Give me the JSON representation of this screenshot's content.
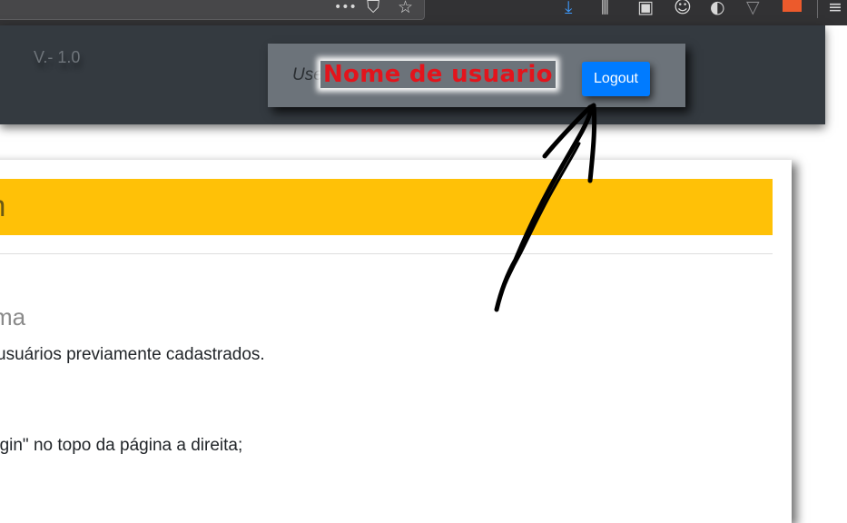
{
  "browser": {
    "toolbar_icons": [
      {
        "name": "more-dots-icon",
        "glyph": "•••"
      },
      {
        "name": "pocket-icon",
        "glyph": "⛉"
      },
      {
        "name": "bookmark-star-icon",
        "glyph": "☆"
      },
      {
        "name": "download-icon",
        "glyph": "⤓"
      },
      {
        "name": "library-icon",
        "glyph": "⫼"
      },
      {
        "name": "reader-sidebar-icon",
        "glyph": "▣"
      },
      {
        "name": "account-icon",
        "glyph": "☺"
      },
      {
        "name": "extension-icon",
        "glyph": "◐"
      },
      {
        "name": "vpn-icon",
        "glyph": "▽"
      },
      {
        "name": "menu-hamburger-icon",
        "glyph": "≡"
      }
    ]
  },
  "header": {
    "version": "V.- 1.0",
    "user_prefix": "Use",
    "username": "Nome de usuario",
    "logout_label": "Logout"
  },
  "card": {
    "banner_title": "n",
    "section_heading": "ma",
    "line_1": "usuários previamente cadastrados.",
    "line_2": "ogin\" no topo da página a direita;"
  },
  "colors": {
    "header_bg": "#343a40",
    "accent_blue": "#007bff",
    "banner_yellow": "#ffc107",
    "username_red": "#e3141c"
  }
}
